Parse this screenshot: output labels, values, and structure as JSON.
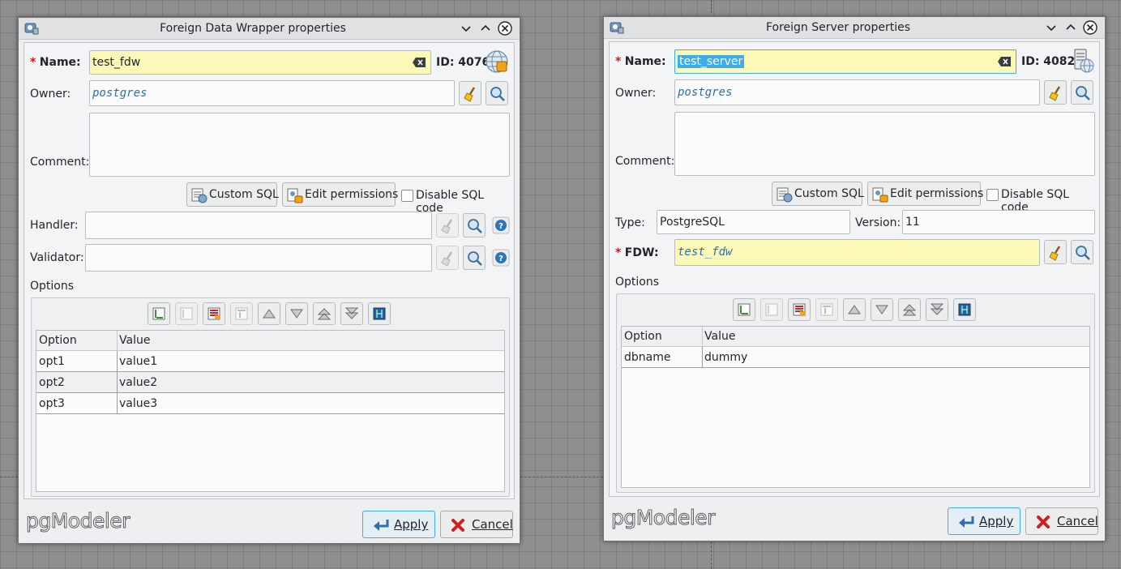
{
  "fdw_window": {
    "title": "Foreign Data Wrapper properties",
    "name_label": "Name:",
    "name_value": "test_fdw",
    "id_label": "ID: 4076",
    "owner_label": "Owner:",
    "owner_value": "postgres",
    "comment_label": "Comment:",
    "comment_value": "",
    "custom_sql": "Custom SQL",
    "edit_permissions": "Edit permissions",
    "disable_sql": "Disable SQL code",
    "handler_label": "Handler:",
    "handler_value": "",
    "validator_label": "Validator:",
    "validator_value": "",
    "options_label": "Options",
    "table": {
      "headers": [
        "Option",
        "Value"
      ],
      "rows": [
        {
          "option": "opt1",
          "value": "value1"
        },
        {
          "option": "opt2",
          "value": "value2"
        },
        {
          "option": "opt3",
          "value": "value3"
        }
      ]
    },
    "logo": "pgModeler",
    "apply_label": "Apply",
    "cancel_label": "Cancel"
  },
  "server_window": {
    "title": "Foreign Server properties",
    "name_label": "Name:",
    "name_value": "test_server",
    "id_label": "ID: 4082",
    "owner_label": "Owner:",
    "owner_value": "postgres",
    "comment_label": "Comment:",
    "comment_value": "",
    "custom_sql": "Custom SQL",
    "edit_permissions": "Edit permissions",
    "disable_sql": "Disable SQL code",
    "type_label": "Type:",
    "type_value": "PostgreSQL",
    "version_label": "Version:",
    "version_value": "11",
    "fdw_label": "FDW:",
    "fdw_value": "test_fdw",
    "options_label": "Options",
    "table": {
      "headers": [
        "Option",
        "Value"
      ],
      "rows": [
        {
          "option": "dbname",
          "value": "dummy"
        }
      ]
    },
    "logo": "pgModeler",
    "apply_label": "Apply",
    "cancel_label": "Cancel"
  },
  "colors": {
    "required_marker": "#cc1a1a",
    "focus_border": "#3daee9",
    "yellow_field": "#fbf8b8"
  },
  "icons": {
    "title_app_icon": "pgmodeler-app-icon",
    "window_controls": [
      "minimize-icon",
      "maximize-icon",
      "close-icon"
    ],
    "field_actions": [
      "clear-broom-icon",
      "search-magnifier-icon",
      "help-icon"
    ],
    "options_toolbar": [
      "add-row-icon",
      "edit-row-icon",
      "remove-row-icon",
      "update-row-icon",
      "move-up-icon",
      "move-down-icon",
      "move-top-icon",
      "move-bottom-icon",
      "resize-columns-icon"
    ],
    "object_type": [
      "fdw-globe-icon",
      "foreign-server-icon"
    ]
  }
}
